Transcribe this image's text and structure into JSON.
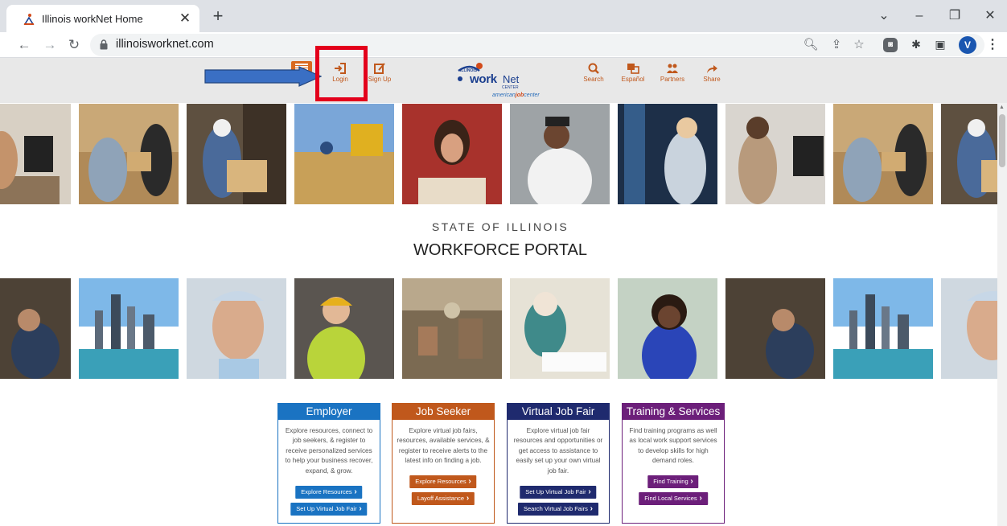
{
  "browser": {
    "tab_title": "Illinois workNet Home",
    "tab_close": "✕",
    "new_tab": "+",
    "url": "illinoisworknet.com",
    "profile_initial": "V",
    "icons": [
      "back-icon",
      "forward-icon",
      "reload-icon",
      "lock-icon",
      "zoom-icon",
      "share-icon",
      "star-icon",
      "extension-icon",
      "puzzle-icon",
      "sidepanel-icon",
      "menu-icon"
    ]
  },
  "header": {
    "login_label": "Login",
    "signup_label": "Sign Up",
    "search_label": "Search",
    "espanol_label": "Español",
    "partners_label": "Partners",
    "share_label": "Share",
    "logo": {
      "state": "ILLINOIS",
      "work": "work",
      "net": "Net",
      "center": "CENTER",
      "ajc_pre": "american",
      "ajc_bold": "job",
      "ajc_post": "center"
    },
    "accent_color": "#c0581c"
  },
  "portal": {
    "subtitle": "STATE OF ILLINOIS",
    "title": "WORKFORCE PORTAL"
  },
  "cards": [
    {
      "title": "Employer",
      "color": "#1a73c2",
      "body": "Explore resources, connect to job seekers, & register to receive personalized services to help your business recover, expand, & grow.",
      "buttons": [
        "Explore Resources",
        "Set Up Virtual Job Fair"
      ]
    },
    {
      "title": "Job Seeker",
      "color": "#c0581c",
      "body": "Explore virtual job fairs, resources, available services, & register to receive alerts to the latest info on finding a job.",
      "buttons": [
        "Explore Resources",
        "Layoff Assistance"
      ]
    },
    {
      "title": "Virtual Job Fair",
      "color": "#1f2a6e",
      "body": "Explore virtual job fair resources and opportunities or get access to assistance to easily set up your own virtual job fair.",
      "buttons": [
        "Set Up Virtual Job Fair",
        "Search Virtual Job Fairs"
      ]
    },
    {
      "title": "Training & Services",
      "color": "#6c1f7a",
      "body": "Find training programs as well as local work support services to develop skills for high demand roles.",
      "buttons": [
        "Find Training",
        "Find Local Services"
      ]
    }
  ]
}
